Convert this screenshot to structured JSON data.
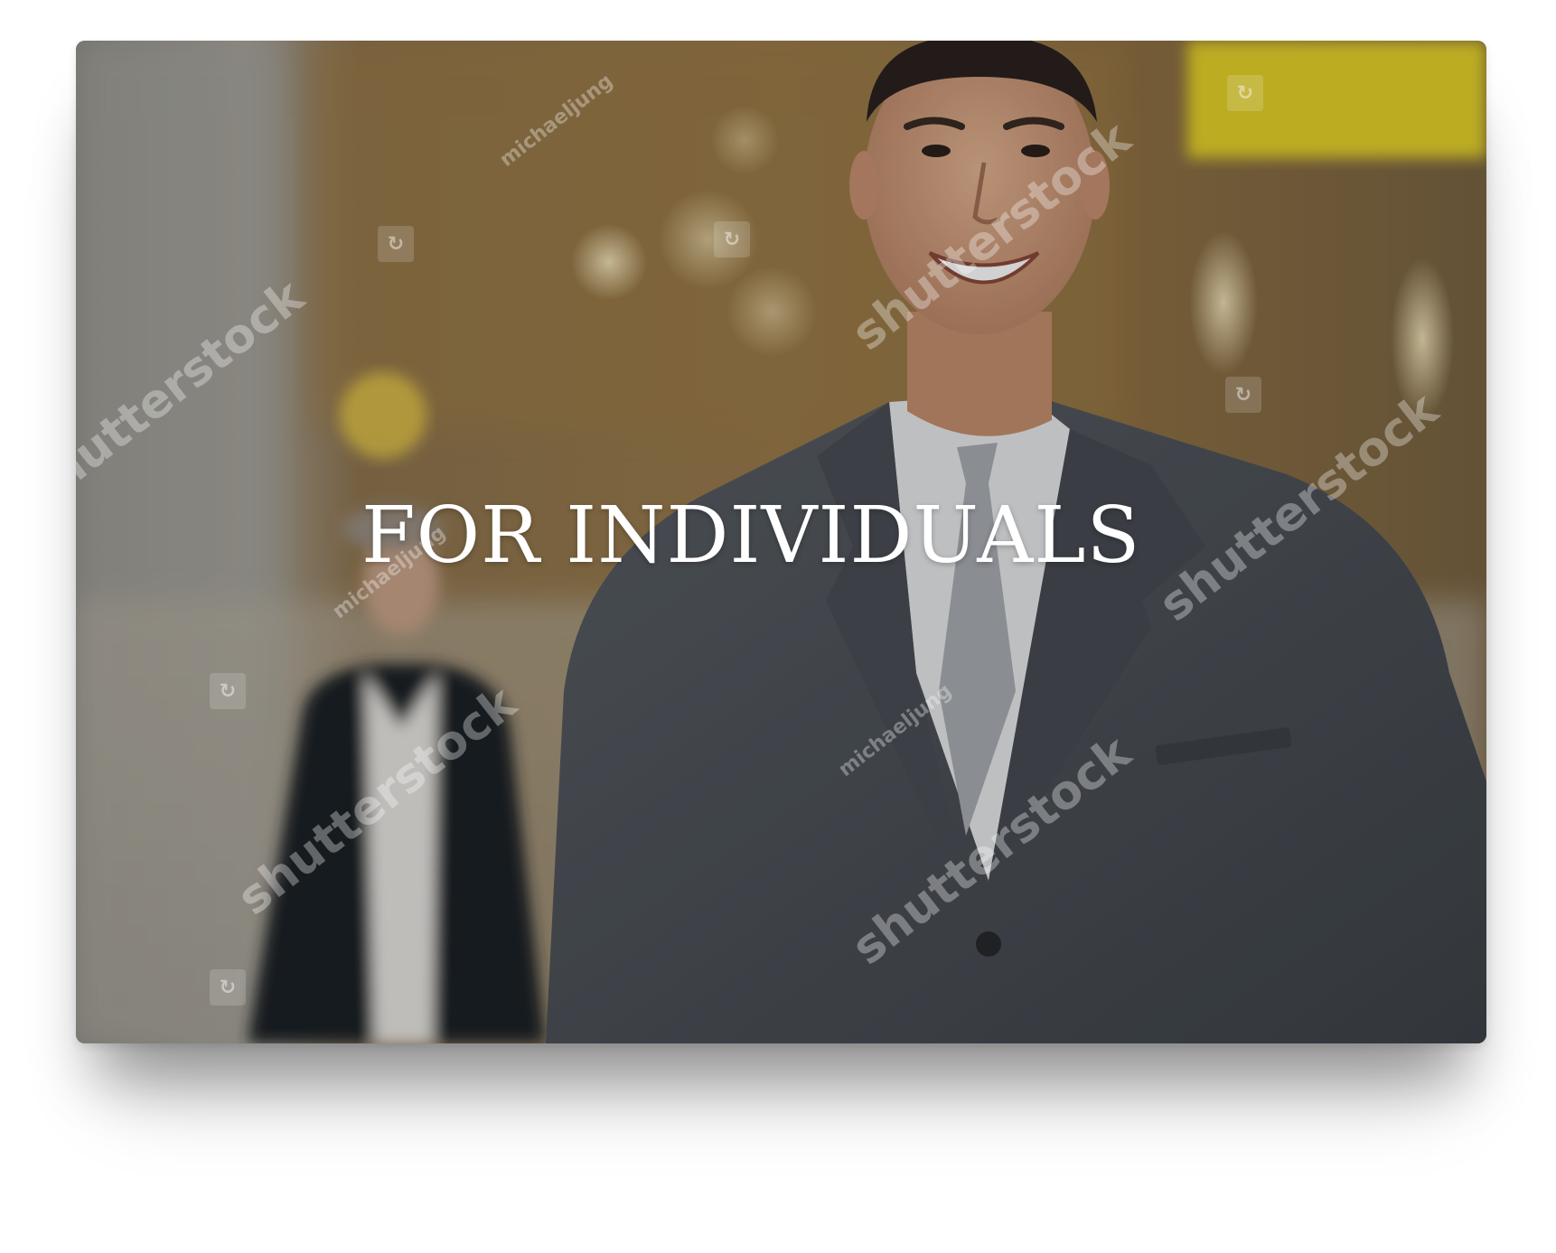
{
  "hero": {
    "title": "FOR INDIVIDUALS",
    "image_subject": "smiling-businessman-in-grey-suit-airport-background"
  },
  "watermark": {
    "brand": "shutterstock",
    "contributor": "michaeljung",
    "icon_glyph": "↻"
  },
  "colors": {
    "title": "#ffffff",
    "suit": "#4f545b",
    "background_warm": "#9c7f52",
    "sign_yellow": "#e6d22a"
  }
}
